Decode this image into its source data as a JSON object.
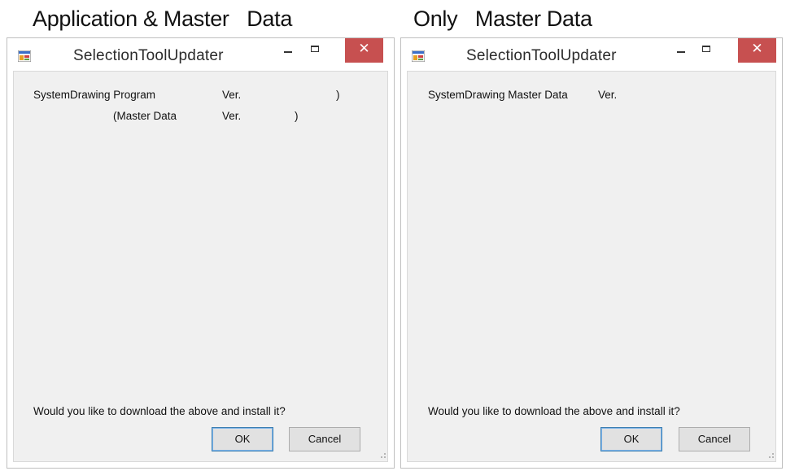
{
  "captions": {
    "left": "Application & Master   Data",
    "right": "Only   Master Data"
  },
  "windows": [
    {
      "title": "SelectionToolUpdater",
      "rows": [
        {
          "name": "SystemDrawing Program",
          "ver": "Ver.",
          "close": ")"
        },
        {
          "name": "(Master Data",
          "ver": "Ver.",
          "close": ")"
        }
      ],
      "question": "Would you like to download the above and install it?",
      "ok_label": "OK",
      "cancel_label": "Cancel"
    },
    {
      "title": "SelectionToolUpdater",
      "rows": [
        {
          "name": "SystemDrawing Master Data",
          "ver": "Ver."
        }
      ],
      "question": "Would you like to download the above and install it?",
      "ok_label": "OK",
      "cancel_label": "Cancel"
    }
  ],
  "icons": {
    "app": "app-form-icon",
    "minimize": "minimize-icon",
    "maximize": "maximize-icon",
    "close": "close-icon",
    "grip": "resize-grip-icon"
  },
  "colors": {
    "close_button": "#c75050",
    "client_bg": "#f0f0f0",
    "default_button_border": "#3c7fb1"
  }
}
